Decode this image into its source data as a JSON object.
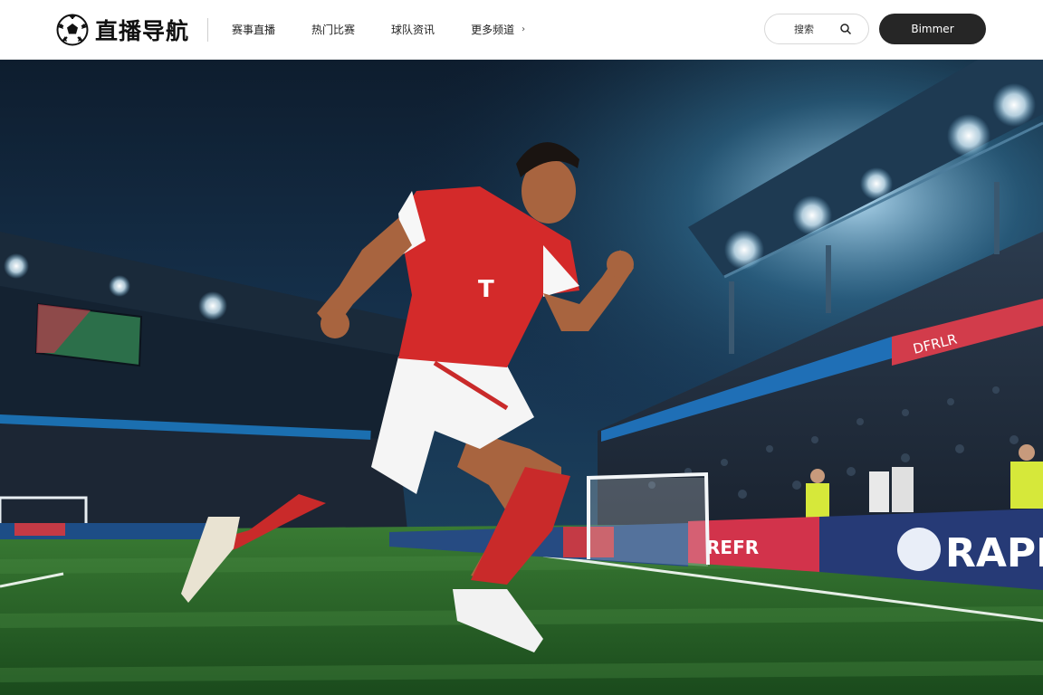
{
  "header": {
    "brand_name": "直播导航",
    "nav": [
      {
        "label": "赛事直播"
      },
      {
        "label": "热门比赛"
      },
      {
        "label": "球队资讯"
      },
      {
        "label": "更多频道",
        "has_dropdown": true
      }
    ],
    "search_text": "搜索",
    "cta_label": "Bimmer"
  },
  "hero": {
    "board_right_text": "RAPI",
    "board_center_text": "REFR",
    "stand_banner_text": "DFRLR"
  },
  "colors": {
    "header_bg": "#ffffff",
    "cta_bg": "#262626",
    "jersey_red": "#d42a2a",
    "pitch_green": "#2d6b2a",
    "night_sky": "#0f2238"
  },
  "icons": [
    "soccer-ball-icon",
    "search-icon",
    "chevron-right-icon"
  ]
}
